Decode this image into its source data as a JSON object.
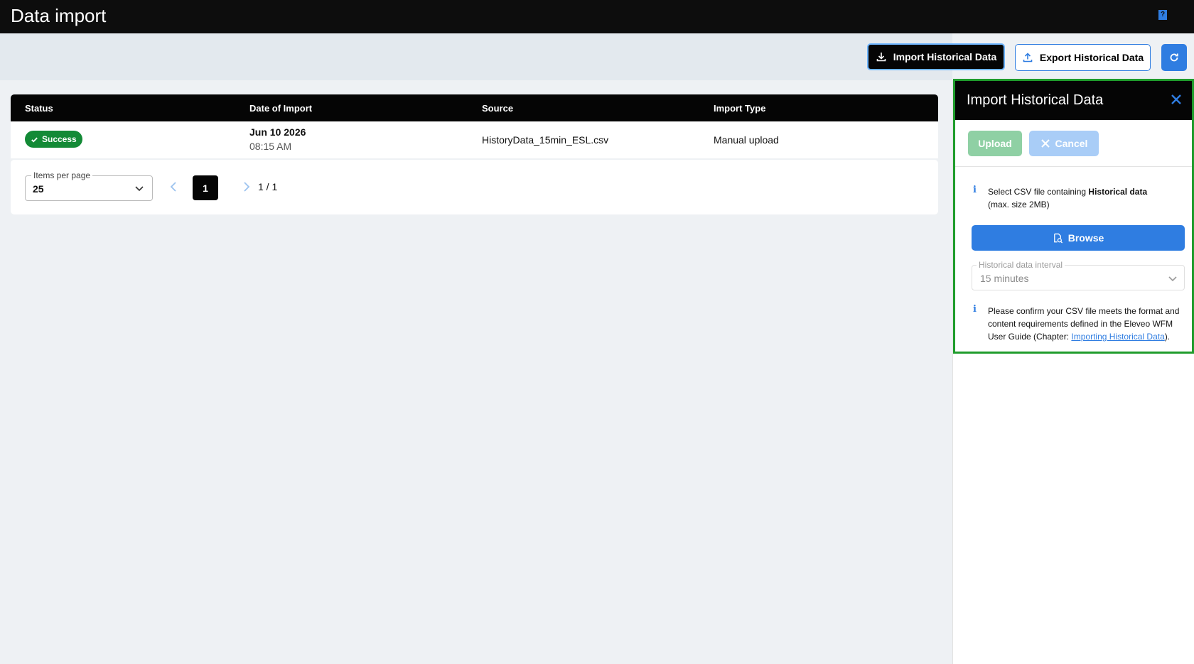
{
  "header": {
    "title": "Data import",
    "help_icon": "help-book-icon"
  },
  "toolbar": {
    "import_label": "Import Historical Data",
    "export_label": "Export Historical Data",
    "refresh_icon": "refresh-icon"
  },
  "table": {
    "columns": [
      "Status",
      "Date of Import",
      "Source",
      "Import Type"
    ],
    "rows": [
      {
        "status": "Success",
        "date": "Jun 10 2026",
        "time": "08:15 AM",
        "source": "HistoryData_15min_ESL.csv",
        "type": "Manual upload"
      }
    ]
  },
  "pagination": {
    "items_per_page_label": "Items per page",
    "items_per_page_value": "25",
    "current_page": "1",
    "page_count": "1 / 1"
  },
  "panel": {
    "title": "Import Historical Data",
    "upload_label": "Upload",
    "cancel_label": "Cancel",
    "info1_prefix": "Select CSV file containing ",
    "info1_bold": "Historical data",
    "info1_suffix": "(max. size 2MB)",
    "browse_label": "Browse",
    "interval_label": "Historical data interval",
    "interval_value": "15 minutes",
    "info2_text": "Please confirm your CSV file meets the format and content requirements defined in the Eleveo WFM User Guide (Chapter: ",
    "info2_link": "Importing Historical Data",
    "info2_end": ")."
  },
  "colors": {
    "accent": "#2f7de1",
    "success": "#138a36",
    "panel_frame": "#1f9c2c",
    "dark": "#050505"
  }
}
